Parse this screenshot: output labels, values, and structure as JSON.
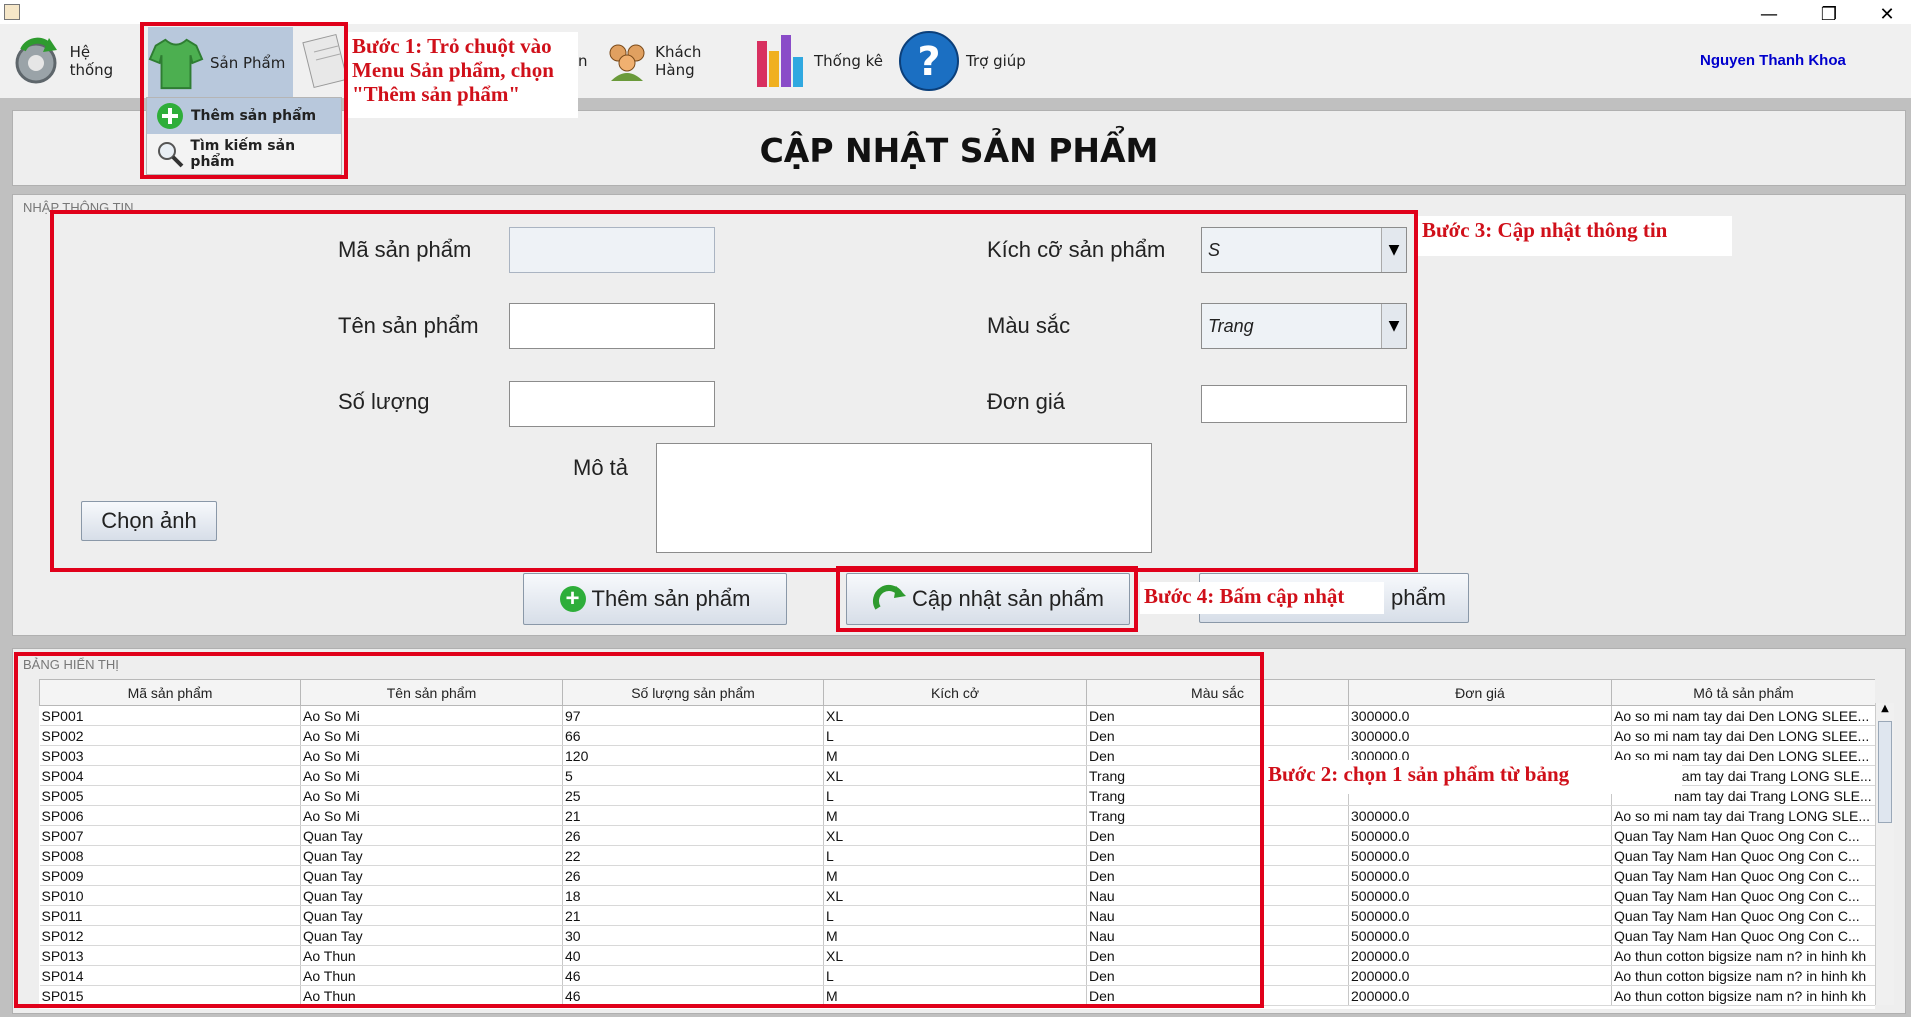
{
  "window": {
    "minimize": "—",
    "maximize": "❐",
    "close": "✕"
  },
  "menubar": {
    "items": [
      {
        "label": "Hệ thống",
        "icon": "gear-refresh-icon"
      },
      {
        "label": "Sản Phẩm",
        "icon": "shirt-icon"
      },
      {
        "label": "Khách Hàng",
        "icon": "people-icon"
      },
      {
        "label": "Thống kê",
        "icon": "bar-chart-icon"
      },
      {
        "label": "Trợ giúp",
        "icon": "help-icon"
      }
    ],
    "partial_hidden_label": "n",
    "user": "Nguyen Thanh Khoa"
  },
  "dropdown": {
    "items": [
      {
        "label": "Thêm sản phẩm",
        "icon": "add-icon"
      },
      {
        "label": "Tìm kiếm sản phẩm",
        "icon": "magnifier-icon"
      }
    ]
  },
  "page_title": "CẬP NHẬT SẢN PHẨM",
  "form": {
    "legend": "NHẬP THÔNG TIN",
    "ma_label": "Mã sản phẩm",
    "ten_label": "Tên sản phẩm",
    "soluong_label": "Số lượng",
    "mota_label": "Mô tả",
    "kichco_label": "Kích cỡ sản phẩm",
    "kichco_value": "S",
    "mausac_label": "Màu sắc",
    "mausac_value": "Trang",
    "dongia_label": "Đơn giá",
    "choose_image": "Chọn ảnh",
    "add_button": "Thêm sản phẩm",
    "update_button": "Cập nhật sản phẩm",
    "third_button_visible": "phẩm"
  },
  "table": {
    "legend": "BẢNG HIỂN THỊ",
    "columns": [
      "Mã sản phẩm",
      "Tên sản phẩm",
      "Số lượng sản phẩm",
      "Kích cở",
      "Màu sắc",
      "Đơn giá",
      "Mô tả sản phẩm"
    ],
    "rows": [
      [
        "SP001",
        "Ao So Mi",
        "97",
        "XL",
        "Den",
        "300000.0",
        "Ao so mi nam tay dai Den LONG SLEE..."
      ],
      [
        "SP002",
        "Ao So Mi",
        "66",
        "L",
        "Den",
        "300000.0",
        "Ao so mi nam tay dai Den LONG SLEE..."
      ],
      [
        "SP003",
        "Ao So Mi",
        "120",
        "M",
        "Den",
        "300000.0",
        "Ao so mi nam tay dai Den LONG SLEE..."
      ],
      [
        "SP004",
        "Ao So Mi",
        "5",
        "XL",
        "Trang",
        "",
        "nam tay dai Trang LONG SLE..."
      ],
      [
        "SP005",
        "Ao So Mi",
        "25",
        "L",
        "Trang",
        "",
        "nam tay dai Trang LONG SLE..."
      ],
      [
        "SP006",
        "Ao So Mi",
        "21",
        "M",
        "Trang",
        "300000.0",
        "Ao so mi nam tay dai Trang LONG SLE..."
      ],
      [
        "SP007",
        "Quan Tay",
        "26",
        "XL",
        "Den",
        "500000.0",
        "Quan Tay Nam Han Quoc Ong Con C..."
      ],
      [
        "SP008",
        "Quan Tay",
        "22",
        "L",
        "Den",
        "500000.0",
        "Quan Tay Nam Han Quoc Ong Con C..."
      ],
      [
        "SP009",
        "Quan Tay",
        "26",
        "M",
        "Den",
        "500000.0",
        "Quan Tay Nam Han Quoc Ong Con C..."
      ],
      [
        "SP010",
        "Quan Tay",
        "18",
        "XL",
        "Nau",
        "500000.0",
        "Quan Tay Nam Han Quoc Ong Con C..."
      ],
      [
        "SP011",
        "Quan Tay",
        "21",
        "L",
        "Nau",
        "500000.0",
        "Quan Tay Nam Han Quoc Ong Con C..."
      ],
      [
        "SP012",
        "Quan Tay",
        "30",
        "M",
        "Nau",
        "500000.0",
        "Quan Tay Nam Han Quoc Ong Con C..."
      ],
      [
        "SP013",
        "Ao Thun",
        "40",
        "XL",
        "Den",
        "200000.0",
        "Ao thun cotton bigsize nam n? in hinh kh"
      ],
      [
        "SP014",
        "Ao Thun",
        "46",
        "L",
        "Den",
        "200000.0",
        "Ao thun cotton bigsize nam n? in hinh kh"
      ],
      [
        "SP015",
        "Ao Thun",
        "46",
        "M",
        "Den",
        "200000.0",
        "Ao thun cotton bigsize nam n? in hinh kh"
      ]
    ]
  },
  "annotations": {
    "step1": "Bước 1: Trỏ chuột vào Menu Sản phẩm, chọn \"Thêm sản phẩm\"",
    "step2": "Bước 2: chọn 1 sản phẩm từ bảng",
    "step3": "Bước 3: Cập nhật thông tin",
    "step4": "Bước 4: Bấm cập nhật"
  },
  "colors": {
    "annotation_red": "#e0001a",
    "user_blue": "#0000cc",
    "menu_highlight": "#b8c8dc"
  }
}
